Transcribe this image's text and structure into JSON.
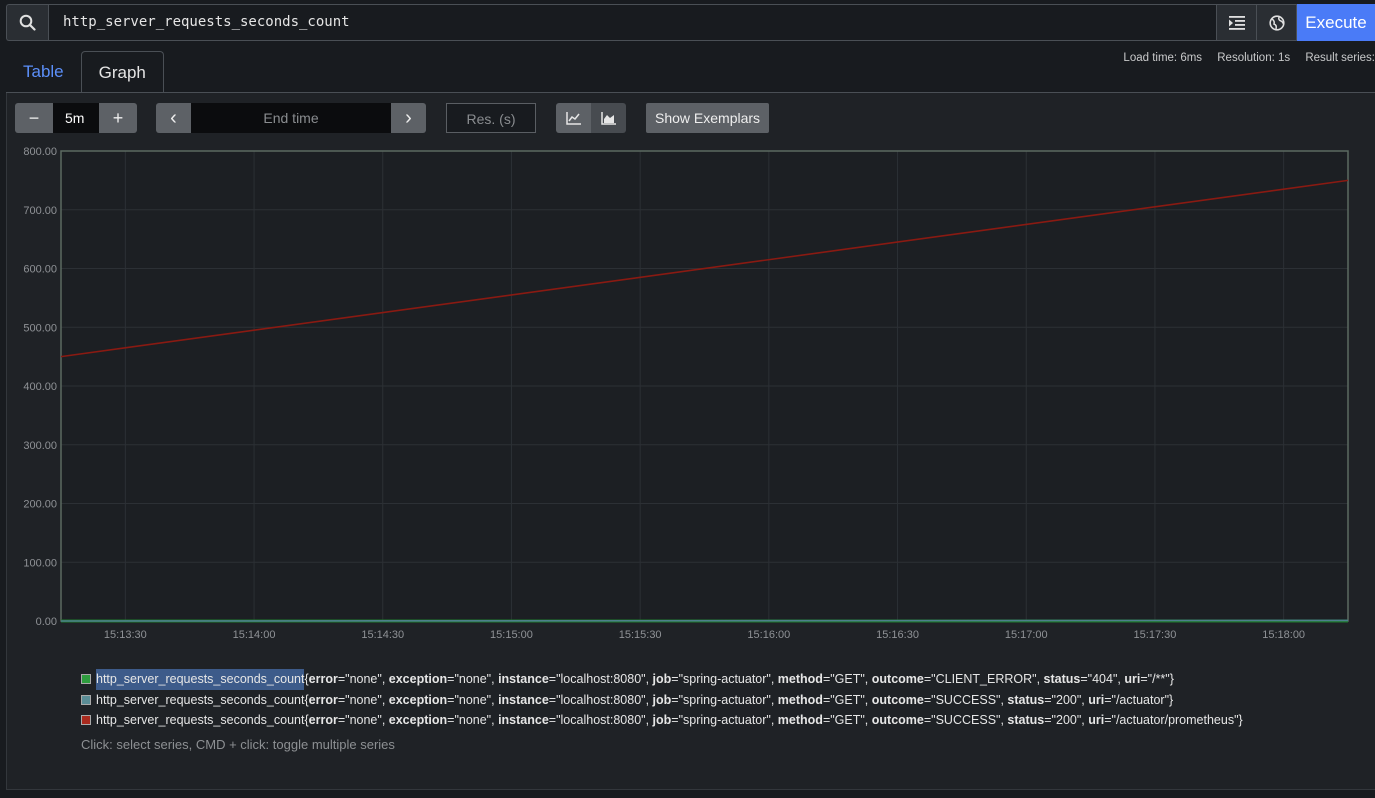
{
  "query": {
    "expression": "http_server_requests_seconds_count",
    "execute_label": "Execute"
  },
  "tabs": [
    {
      "label": "Table",
      "active": false
    },
    {
      "label": "Graph",
      "active": true
    }
  ],
  "stats": {
    "load_time": "Load time: 6ms",
    "resolution": "Resolution: 1s",
    "result_series": "Result series:"
  },
  "controls": {
    "range_minus": "−",
    "range_value": "5m",
    "range_plus": "+",
    "prev": "‹",
    "end_time_placeholder": "End time",
    "next": "›",
    "res_placeholder": "Res. (s)",
    "show_exemplars": "Show Exemplars"
  },
  "chart_data": {
    "type": "line",
    "y_ticks": [
      "800.00",
      "700.00",
      "600.00",
      "500.00",
      "400.00",
      "300.00",
      "200.00",
      "100.00",
      "0.00"
    ],
    "ylim": [
      0,
      800
    ],
    "x_ticks": [
      "15:13:30",
      "15:14:00",
      "15:14:30",
      "15:15:00",
      "15:15:30",
      "15:16:00",
      "15:16:30",
      "15:17:00",
      "15:17:30",
      "15:18:00"
    ],
    "grid": true,
    "series": [
      {
        "color": "#1e7a2c",
        "x": [
          "15:13:15",
          "15:18:15"
        ],
        "values": [
          0,
          0
        ]
      },
      {
        "color": "#4d7f8c",
        "x": [
          "15:13:15",
          "15:18:15"
        ],
        "values": [
          0,
          1
        ]
      },
      {
        "color": "#8a1a12",
        "x": [
          "15:13:15",
          "15:18:15"
        ],
        "values": [
          450,
          750
        ]
      }
    ]
  },
  "legend": {
    "items": [
      {
        "color": "#2e9c3e",
        "metric": "http_server_requests_seconds_count",
        "labels": [
          [
            "error",
            "none"
          ],
          [
            "exception",
            "none"
          ],
          [
            "instance",
            "localhost:8080"
          ],
          [
            "job",
            "spring-actuator"
          ],
          [
            "method",
            "GET"
          ],
          [
            "outcome",
            "CLIENT_ERROR"
          ],
          [
            "status",
            "404"
          ],
          [
            "uri",
            "/**"
          ]
        ],
        "highlight": true
      },
      {
        "color": "#5a8d96",
        "metric": "http_server_requests_seconds_count",
        "labels": [
          [
            "error",
            "none"
          ],
          [
            "exception",
            "none"
          ],
          [
            "instance",
            "localhost:8080"
          ],
          [
            "job",
            "spring-actuator"
          ],
          [
            "method",
            "GET"
          ],
          [
            "outcome",
            "SUCCESS"
          ],
          [
            "status",
            "200"
          ],
          [
            "uri",
            "/actuator"
          ]
        ],
        "highlight": false
      },
      {
        "color": "#a82a1e",
        "metric": "http_server_requests_seconds_count",
        "labels": [
          [
            "error",
            "none"
          ],
          [
            "exception",
            "none"
          ],
          [
            "instance",
            "localhost:8080"
          ],
          [
            "job",
            "spring-actuator"
          ],
          [
            "method",
            "GET"
          ],
          [
            "outcome",
            "SUCCESS"
          ],
          [
            "status",
            "200"
          ],
          [
            "uri",
            "/actuator/prometheus"
          ]
        ],
        "highlight": false
      }
    ],
    "hint": "Click: select series, CMD + click: toggle multiple series"
  }
}
